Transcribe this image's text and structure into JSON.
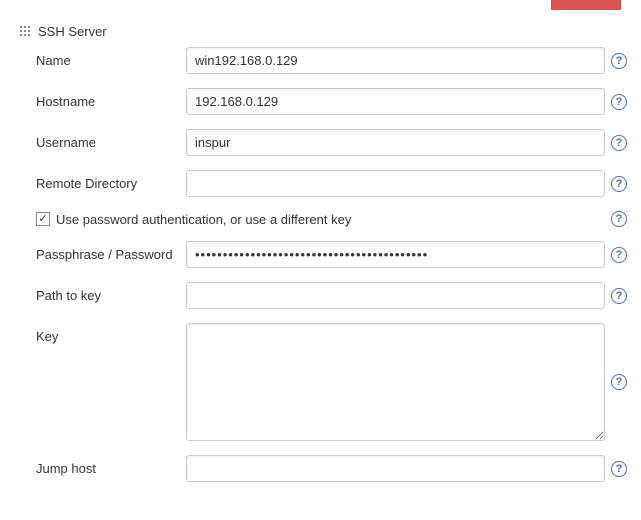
{
  "section": {
    "title": "SSH Server"
  },
  "fields": {
    "name": {
      "label": "Name",
      "value": "win192.168.0.129"
    },
    "hostname": {
      "label": "Hostname",
      "value": "192.168.0.129"
    },
    "username": {
      "label": "Username",
      "value": "inspur"
    },
    "remote_dir": {
      "label": "Remote Directory",
      "value": ""
    },
    "use_pw": {
      "label": "Use password authentication, or use a different key",
      "checked": true
    },
    "passphrase": {
      "label": "Passphrase / Password",
      "value": "••••••••••••••••••••••••••••••••••••••••••"
    },
    "path_to_key": {
      "label": "Path to key",
      "value": ""
    },
    "key": {
      "label": "Key",
      "value": ""
    },
    "jump_host": {
      "label": "Jump host",
      "value": ""
    }
  },
  "help_glyph": "?"
}
